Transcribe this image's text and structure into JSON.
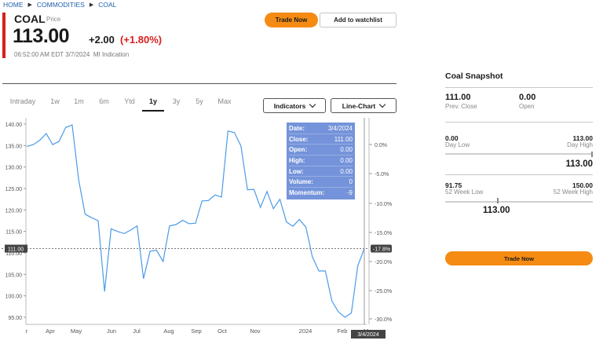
{
  "breadcrumb": [
    "HOME",
    "COMMODITIES",
    "COAL"
  ],
  "quote": {
    "ticker": "COAL",
    "ticker_sub": "Price",
    "price": "113.00",
    "change": "+2.00",
    "change_pct": "(+1.80%)",
    "timestamp": "06:52:00 AM EDT 3/7/2024",
    "indication": "MI Indication",
    "change_color": "#d81e1e"
  },
  "actions": {
    "trade_now": "Trade Now",
    "add_watchlist": "Add to watchlist"
  },
  "tabs": [
    {
      "label": "Intraday",
      "active": false
    },
    {
      "label": "1w",
      "active": false
    },
    {
      "label": "1m",
      "active": false
    },
    {
      "label": "6m",
      "active": false
    },
    {
      "label": "Ytd",
      "active": false
    },
    {
      "label": "1y",
      "active": true
    },
    {
      "label": "3y",
      "active": false
    },
    {
      "label": "5y",
      "active": false
    },
    {
      "label": "Max",
      "active": false
    }
  ],
  "controls": {
    "indicators": "Indicators",
    "chart_type": "Line-Chart"
  },
  "tooltip": [
    {
      "label": "Date:",
      "value": "3/4/2024"
    },
    {
      "label": "Close:",
      "value": "111.00"
    },
    {
      "label": "Open:",
      "value": "0.00"
    },
    {
      "label": "High:",
      "value": "0.00"
    },
    {
      "label": "Low:",
      "value": "0.00"
    },
    {
      "label": "Volume:",
      "value": "0"
    },
    {
      "label": "Momentum:",
      "value": "-9"
    }
  ],
  "chart_data": {
    "type": "line",
    "color": "#4a9be8",
    "x_labels": [
      "r",
      "Apr",
      "May",
      "Jun",
      "Jul",
      "Aug",
      "Sep",
      "Oct",
      "Nov",
      "2024",
      "Feb",
      "M"
    ],
    "y_left_ticks": [
      "140.00",
      "135.00",
      "130.00",
      "125.00",
      "120.00",
      "115.00",
      "110.00",
      "105.00",
      "100.00",
      "95.00"
    ],
    "y_right_ticks": [
      "0.0%",
      "-5.0%",
      "-10.0%",
      "-15.0%",
      "-20.0%",
      "-25.0%",
      "-30.0%"
    ],
    "ylim": [
      93,
      141
    ],
    "crosshair_y_label": "111.00",
    "crosshair_pct_label": "-17.8%",
    "crosshair_date_label": "3/4/2024",
    "crosshair_y": 111,
    "values": [
      134.8,
      135.2,
      136.2,
      137.8,
      135.2,
      136.0,
      139.2,
      139.8,
      127,
      119,
      118.2,
      117.5,
      101,
      115.6,
      115,
      114.5,
      115.3,
      116.3,
      104,
      110.4,
      110.6,
      108,
      116.3,
      116.6,
      117.6,
      116.8,
      116.9,
      122.1,
      122.2,
      123.5,
      123.0,
      138.4,
      138.0,
      134.9,
      124.7,
      124.8,
      120.6,
      124.3,
      120.3,
      122.5,
      117.2,
      116.2,
      117.8,
      116.0,
      109.1,
      105.8,
      105.8,
      98.8,
      96.3,
      95.0,
      96.0,
      107.0,
      111.0
    ]
  },
  "snapshot": {
    "title": "Coal Snapshot",
    "prev_close": "111.00",
    "prev_close_label": "Prev. Close",
    "open": "0.00",
    "open_label": "Open",
    "day_low": "0.00",
    "day_low_label": "Day Low",
    "day_high": "113.00",
    "day_high_label": "Day High",
    "day_current": "113.00",
    "wk_low": "91.75",
    "wk_low_label": "52 Week Low",
    "wk_high": "150.00",
    "wk_high_label": "52 Week High",
    "wk_current": "113.00",
    "trade_now": "Trade Now"
  }
}
